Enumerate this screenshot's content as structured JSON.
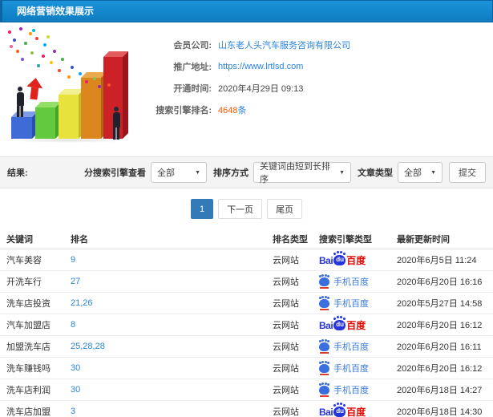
{
  "header": {
    "title": "网络营销效果展示"
  },
  "info": {
    "rows": [
      {
        "label": "会员公司:",
        "value": "山东老人头汽车服务咨询有限公司"
      },
      {
        "label": "推广地址:",
        "value": "https://www.lrtlsd.com"
      },
      {
        "label": "开通时间:",
        "value": "2020年4月29日 09:13"
      },
      {
        "label": "搜索引擎排名:",
        "value": "4648",
        "suffix": "条"
      }
    ]
  },
  "filters": {
    "result_label": "结果:",
    "engine_filter_label": "分搜索引擎查看",
    "engine_filter_value": "全部",
    "sort_label": "排序方式",
    "sort_value": "关键词由短到长排序",
    "article_label": "文章类型",
    "article_value": "全部",
    "submit_label": "提交"
  },
  "pagination": {
    "current": "1",
    "next": "下一页",
    "last": "尾页"
  },
  "engines": {
    "baidu_prefix": "Bai",
    "baidu_du": "du",
    "baidu_suffix": "百度",
    "mobile": "手机百度"
  },
  "table": {
    "columns": {
      "keyword": "关键词",
      "rank": "排名",
      "rank_type": "排名类型",
      "engine_type": "搜索引擎类型",
      "updated": "最新更新时间"
    },
    "rows": [
      {
        "keyword": "汽车美容",
        "rank": "9",
        "rank_type": "云网站",
        "engine": "baidu-pc",
        "time": "2020年6月5日 11:24"
      },
      {
        "keyword": "开洗车行",
        "rank": "27",
        "rank_type": "云网站",
        "engine": "baidu-mobile",
        "time": "2020年6月20日 16:16"
      },
      {
        "keyword": "洗车店投资",
        "rank": "21,26",
        "rank_type": "云网站",
        "engine": "baidu-mobile",
        "time": "2020年5月27日 14:58"
      },
      {
        "keyword": "汽车加盟店",
        "rank": "8",
        "rank_type": "云网站",
        "engine": "baidu-pc",
        "time": "2020年6月20日 16:12"
      },
      {
        "keyword": "加盟洗车店",
        "rank": "25,28,28",
        "rank_type": "云网站",
        "engine": "baidu-mobile",
        "time": "2020年6月20日 16:11"
      },
      {
        "keyword": "洗车赚钱吗",
        "rank": "30",
        "rank_type": "云网站",
        "engine": "baidu-mobile",
        "time": "2020年6月20日 16:12"
      },
      {
        "keyword": "洗车店利润",
        "rank": "30",
        "rank_type": "云网站",
        "engine": "baidu-mobile",
        "time": "2020年6月18日 14:27"
      },
      {
        "keyword": "洗车店加盟",
        "rank": "3",
        "rank_type": "云网站",
        "engine": "baidu-pc",
        "time": "2020年6月18日 14:30"
      }
    ]
  },
  "colors": {
    "header_blue": "#1286cf",
    "link_blue": "#2a84dd",
    "count_orange": "#ff5a00",
    "active_page_blue": "#337ab7",
    "baidu_blue": "#2534dc",
    "baidu_red": "#e10601"
  }
}
